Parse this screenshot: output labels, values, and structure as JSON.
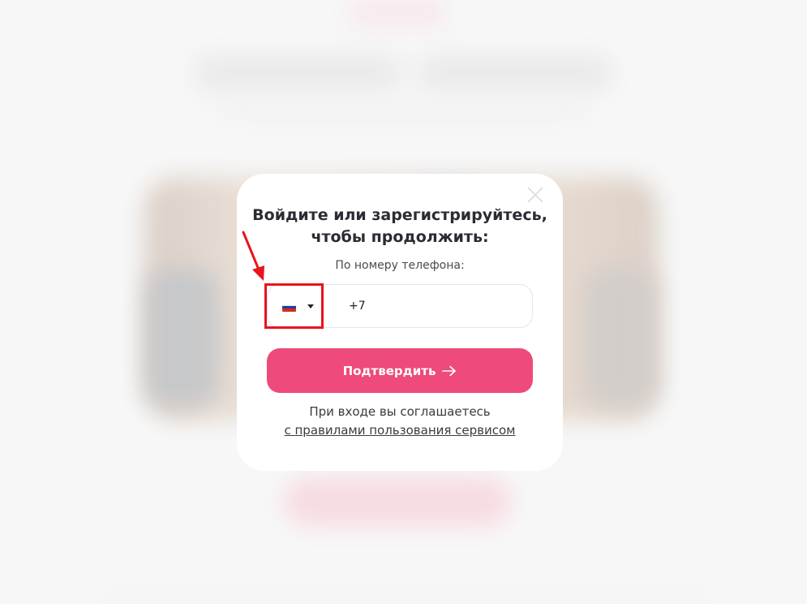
{
  "modal": {
    "title_line1": "Войдите или зарегистрируйтесь,",
    "title_line2": "чтобы продолжить:",
    "phone_label": "По номеру телефона:",
    "phone_prefix": "+7",
    "country_flag": "russia-flag-icon",
    "confirm_label": "Подтвердить",
    "terms_text": "При входе вы соглашаетесь",
    "terms_link": "с правилами пользования сервисом"
  },
  "colors": {
    "accent": "#ee4a7b",
    "highlight": "#e8141e"
  }
}
